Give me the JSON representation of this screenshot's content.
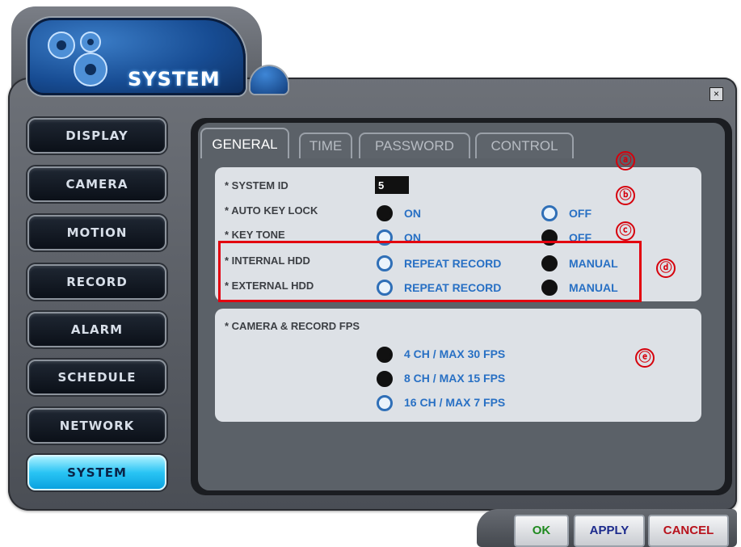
{
  "header": {
    "title": "SYSTEM"
  },
  "close_label": "×",
  "sidebar": {
    "items": [
      {
        "label": "DISPLAY"
      },
      {
        "label": "CAMERA"
      },
      {
        "label": "MOTION"
      },
      {
        "label": "RECORD"
      },
      {
        "label": "ALARM"
      },
      {
        "label": "SCHEDULE"
      },
      {
        "label": "NETWORK"
      },
      {
        "label": "SYSTEM",
        "active": true
      }
    ]
  },
  "tabs": [
    {
      "label": "GENERAL",
      "active": true
    },
    {
      "label": "TIME"
    },
    {
      "label": "PASSWORD"
    },
    {
      "label": "CONTROL"
    }
  ],
  "general": {
    "system_id": {
      "label": "* SYSTEM ID",
      "value": "5"
    },
    "auto_key_lock": {
      "label": "* AUTO KEY LOCK",
      "on": "ON",
      "off": "OFF",
      "selected": "ON"
    },
    "key_tone": {
      "label": "* KEY TONE",
      "on": "ON",
      "off": "OFF",
      "selected": "OFF"
    },
    "internal_hdd": {
      "label": "* INTERNAL HDD",
      "repeat": "REPEAT RECORD",
      "manual": "MANUAL",
      "selected": "MANUAL"
    },
    "external_hdd": {
      "label": "* EXTERNAL HDD",
      "repeat": "REPEAT RECORD",
      "manual": "MANUAL",
      "selected": "MANUAL"
    }
  },
  "fps": {
    "label": "* CAMERA & RECORD FPS",
    "options": [
      "4 CH / MAX 30 FPS",
      "8 CH / MAX 15 FPS",
      "16 CH / MAX 7 FPS"
    ],
    "selected": [
      "4 CH / MAX 30 FPS",
      "8 CH / MAX 15 FPS"
    ]
  },
  "markers": [
    "ⓐ",
    "ⓑ",
    "ⓒ",
    "ⓓ",
    "ⓔ"
  ],
  "footer": {
    "ok": "OK",
    "apply": "APPLY",
    "cancel": "CANCEL"
  },
  "colors": {
    "highlight": "#e3000f",
    "option_text": "#2870c4",
    "active_side": "#29c4f4"
  }
}
